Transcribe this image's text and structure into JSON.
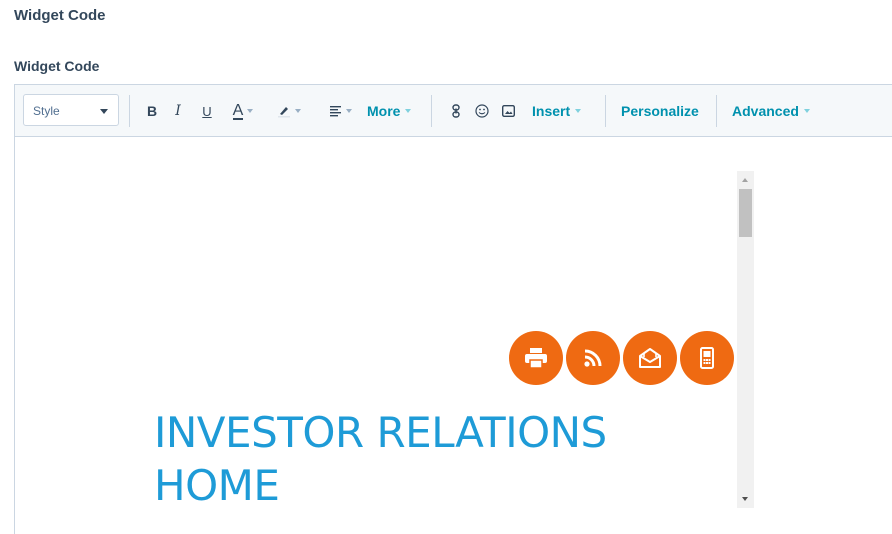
{
  "section": {
    "title": "Widget Code"
  },
  "field": {
    "label": "Widget Code"
  },
  "toolbar": {
    "style_select": "Style",
    "bold": "B",
    "italic": "I",
    "underline": "U",
    "font_color": "A",
    "more_label": "More",
    "insert_label": "Insert",
    "personalize_label": "Personalize",
    "advanced_label": "Advanced"
  },
  "preview": {
    "heading_line1": "INVESTOR RELATIONS",
    "heading_line2": "HOME",
    "icons": [
      "printer-icon",
      "rss-icon",
      "email-alert-icon",
      "mobile-icon"
    ]
  },
  "colors": {
    "accent_orange": "#ef6a12",
    "heading_blue": "#1e9bd7",
    "link_teal": "#0091ae",
    "text_dark": "#33475b"
  }
}
